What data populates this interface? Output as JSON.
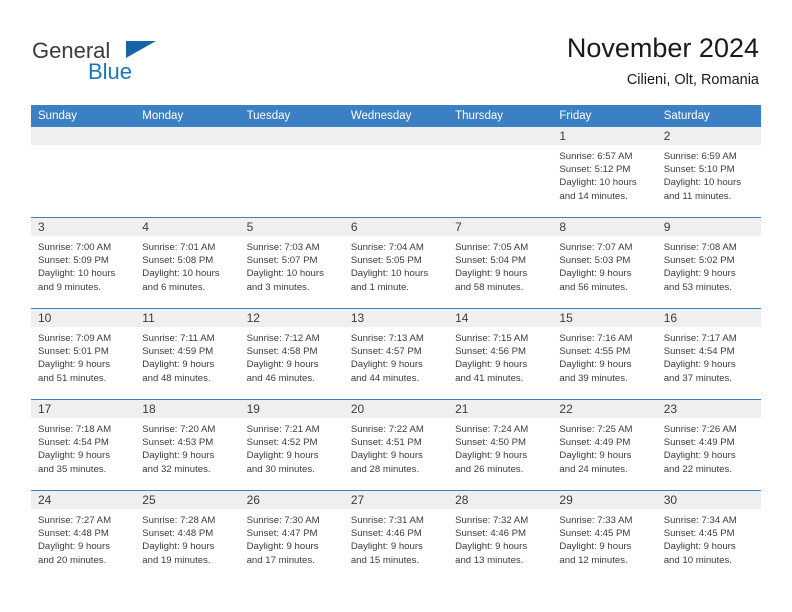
{
  "brand": {
    "name_primary": "General",
    "name_secondary": "Blue",
    "flag_icon": "triangle-flag-icon",
    "primary_color": "#1b76bc",
    "header_color": "#3b7fc4"
  },
  "header": {
    "title": "November 2024",
    "location": "Cilieni, Olt, Romania"
  },
  "calendar": {
    "weekday_headers": [
      "Sunday",
      "Monday",
      "Tuesday",
      "Wednesday",
      "Thursday",
      "Friday",
      "Saturday"
    ],
    "weeks": [
      [
        {
          "day": "",
          "empty": true,
          "sunrise": "",
          "sunset": "",
          "daylight_line1": "",
          "daylight_line2": ""
        },
        {
          "day": "",
          "empty": true,
          "sunrise": "",
          "sunset": "",
          "daylight_line1": "",
          "daylight_line2": ""
        },
        {
          "day": "",
          "empty": true,
          "sunrise": "",
          "sunset": "",
          "daylight_line1": "",
          "daylight_line2": ""
        },
        {
          "day": "",
          "empty": true,
          "sunrise": "",
          "sunset": "",
          "daylight_line1": "",
          "daylight_line2": ""
        },
        {
          "day": "",
          "empty": true,
          "sunrise": "",
          "sunset": "",
          "daylight_line1": "",
          "daylight_line2": ""
        },
        {
          "day": "1",
          "empty": false,
          "sunrise": "Sunrise: 6:57 AM",
          "sunset": "Sunset: 5:12 PM",
          "daylight_line1": "Daylight: 10 hours",
          "daylight_line2": "and 14 minutes."
        },
        {
          "day": "2",
          "empty": false,
          "sunrise": "Sunrise: 6:59 AM",
          "sunset": "Sunset: 5:10 PM",
          "daylight_line1": "Daylight: 10 hours",
          "daylight_line2": "and 11 minutes."
        }
      ],
      [
        {
          "day": "3",
          "empty": false,
          "sunrise": "Sunrise: 7:00 AM",
          "sunset": "Sunset: 5:09 PM",
          "daylight_line1": "Daylight: 10 hours",
          "daylight_line2": "and 9 minutes."
        },
        {
          "day": "4",
          "empty": false,
          "sunrise": "Sunrise: 7:01 AM",
          "sunset": "Sunset: 5:08 PM",
          "daylight_line1": "Daylight: 10 hours",
          "daylight_line2": "and 6 minutes."
        },
        {
          "day": "5",
          "empty": false,
          "sunrise": "Sunrise: 7:03 AM",
          "sunset": "Sunset: 5:07 PM",
          "daylight_line1": "Daylight: 10 hours",
          "daylight_line2": "and 3 minutes."
        },
        {
          "day": "6",
          "empty": false,
          "sunrise": "Sunrise: 7:04 AM",
          "sunset": "Sunset: 5:05 PM",
          "daylight_line1": "Daylight: 10 hours",
          "daylight_line2": "and 1 minute."
        },
        {
          "day": "7",
          "empty": false,
          "sunrise": "Sunrise: 7:05 AM",
          "sunset": "Sunset: 5:04 PM",
          "daylight_line1": "Daylight: 9 hours",
          "daylight_line2": "and 58 minutes."
        },
        {
          "day": "8",
          "empty": false,
          "sunrise": "Sunrise: 7:07 AM",
          "sunset": "Sunset: 5:03 PM",
          "daylight_line1": "Daylight: 9 hours",
          "daylight_line2": "and 56 minutes."
        },
        {
          "day": "9",
          "empty": false,
          "sunrise": "Sunrise: 7:08 AM",
          "sunset": "Sunset: 5:02 PM",
          "daylight_line1": "Daylight: 9 hours",
          "daylight_line2": "and 53 minutes."
        }
      ],
      [
        {
          "day": "10",
          "empty": false,
          "sunrise": "Sunrise: 7:09 AM",
          "sunset": "Sunset: 5:01 PM",
          "daylight_line1": "Daylight: 9 hours",
          "daylight_line2": "and 51 minutes."
        },
        {
          "day": "11",
          "empty": false,
          "sunrise": "Sunrise: 7:11 AM",
          "sunset": "Sunset: 4:59 PM",
          "daylight_line1": "Daylight: 9 hours",
          "daylight_line2": "and 48 minutes."
        },
        {
          "day": "12",
          "empty": false,
          "sunrise": "Sunrise: 7:12 AM",
          "sunset": "Sunset: 4:58 PM",
          "daylight_line1": "Daylight: 9 hours",
          "daylight_line2": "and 46 minutes."
        },
        {
          "day": "13",
          "empty": false,
          "sunrise": "Sunrise: 7:13 AM",
          "sunset": "Sunset: 4:57 PM",
          "daylight_line1": "Daylight: 9 hours",
          "daylight_line2": "and 44 minutes."
        },
        {
          "day": "14",
          "empty": false,
          "sunrise": "Sunrise: 7:15 AM",
          "sunset": "Sunset: 4:56 PM",
          "daylight_line1": "Daylight: 9 hours",
          "daylight_line2": "and 41 minutes."
        },
        {
          "day": "15",
          "empty": false,
          "sunrise": "Sunrise: 7:16 AM",
          "sunset": "Sunset: 4:55 PM",
          "daylight_line1": "Daylight: 9 hours",
          "daylight_line2": "and 39 minutes."
        },
        {
          "day": "16",
          "empty": false,
          "sunrise": "Sunrise: 7:17 AM",
          "sunset": "Sunset: 4:54 PM",
          "daylight_line1": "Daylight: 9 hours",
          "daylight_line2": "and 37 minutes."
        }
      ],
      [
        {
          "day": "17",
          "empty": false,
          "sunrise": "Sunrise: 7:18 AM",
          "sunset": "Sunset: 4:54 PM",
          "daylight_line1": "Daylight: 9 hours",
          "daylight_line2": "and 35 minutes."
        },
        {
          "day": "18",
          "empty": false,
          "sunrise": "Sunrise: 7:20 AM",
          "sunset": "Sunset: 4:53 PM",
          "daylight_line1": "Daylight: 9 hours",
          "daylight_line2": "and 32 minutes."
        },
        {
          "day": "19",
          "empty": false,
          "sunrise": "Sunrise: 7:21 AM",
          "sunset": "Sunset: 4:52 PM",
          "daylight_line1": "Daylight: 9 hours",
          "daylight_line2": "and 30 minutes."
        },
        {
          "day": "20",
          "empty": false,
          "sunrise": "Sunrise: 7:22 AM",
          "sunset": "Sunset: 4:51 PM",
          "daylight_line1": "Daylight: 9 hours",
          "daylight_line2": "and 28 minutes."
        },
        {
          "day": "21",
          "empty": false,
          "sunrise": "Sunrise: 7:24 AM",
          "sunset": "Sunset: 4:50 PM",
          "daylight_line1": "Daylight: 9 hours",
          "daylight_line2": "and 26 minutes."
        },
        {
          "day": "22",
          "empty": false,
          "sunrise": "Sunrise: 7:25 AM",
          "sunset": "Sunset: 4:49 PM",
          "daylight_line1": "Daylight: 9 hours",
          "daylight_line2": "and 24 minutes."
        },
        {
          "day": "23",
          "empty": false,
          "sunrise": "Sunrise: 7:26 AM",
          "sunset": "Sunset: 4:49 PM",
          "daylight_line1": "Daylight: 9 hours",
          "daylight_line2": "and 22 minutes."
        }
      ],
      [
        {
          "day": "24",
          "empty": false,
          "sunrise": "Sunrise: 7:27 AM",
          "sunset": "Sunset: 4:48 PM",
          "daylight_line1": "Daylight: 9 hours",
          "daylight_line2": "and 20 minutes."
        },
        {
          "day": "25",
          "empty": false,
          "sunrise": "Sunrise: 7:28 AM",
          "sunset": "Sunset: 4:48 PM",
          "daylight_line1": "Daylight: 9 hours",
          "daylight_line2": "and 19 minutes."
        },
        {
          "day": "26",
          "empty": false,
          "sunrise": "Sunrise: 7:30 AM",
          "sunset": "Sunset: 4:47 PM",
          "daylight_line1": "Daylight: 9 hours",
          "daylight_line2": "and 17 minutes."
        },
        {
          "day": "27",
          "empty": false,
          "sunrise": "Sunrise: 7:31 AM",
          "sunset": "Sunset: 4:46 PM",
          "daylight_line1": "Daylight: 9 hours",
          "daylight_line2": "and 15 minutes."
        },
        {
          "day": "28",
          "empty": false,
          "sunrise": "Sunrise: 7:32 AM",
          "sunset": "Sunset: 4:46 PM",
          "daylight_line1": "Daylight: 9 hours",
          "daylight_line2": "and 13 minutes."
        },
        {
          "day": "29",
          "empty": false,
          "sunrise": "Sunrise: 7:33 AM",
          "sunset": "Sunset: 4:45 PM",
          "daylight_line1": "Daylight: 9 hours",
          "daylight_line2": "and 12 minutes."
        },
        {
          "day": "30",
          "empty": false,
          "sunrise": "Sunrise: 7:34 AM",
          "sunset": "Sunset: 4:45 PM",
          "daylight_line1": "Daylight: 9 hours",
          "daylight_line2": "and 10 minutes."
        }
      ]
    ]
  }
}
